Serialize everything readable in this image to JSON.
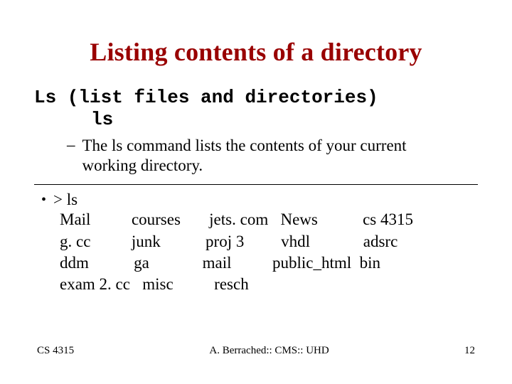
{
  "title": "Listing contents of a directory",
  "cmd_intro": "Ls (list files and directories)",
  "cmd_name": "ls",
  "description": "The ls command lists the contents of your current working directory.",
  "prompt_line": "> ls",
  "listing": "Mail          courses       jets. com   News           cs 4315\ng. cc          junk           proj 3         vhdl             adsrc\nddm           ga             mail          public_html  bin\nexam 2. cc   misc          resch",
  "footer_left": "CS 4315",
  "footer_center": "A. Berrached:: CMS:: UHD",
  "footer_right": "12"
}
